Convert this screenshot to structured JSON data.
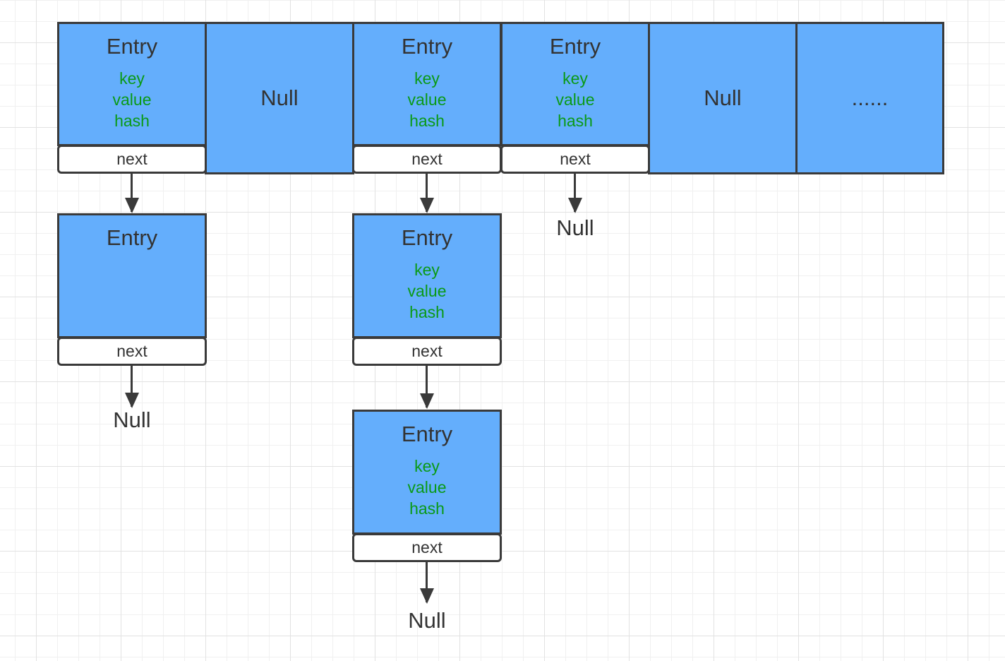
{
  "colors": {
    "cell_fill": "#64aefc",
    "border": "#3a3a3a",
    "field_text": "#0a9a17",
    "next_fill": "#ffffff"
  },
  "labels": {
    "entry": "Entry",
    "key": "key",
    "value": "value",
    "hash": "hash",
    "next": "next",
    "null": "Null",
    "ellipsis": "......"
  }
}
